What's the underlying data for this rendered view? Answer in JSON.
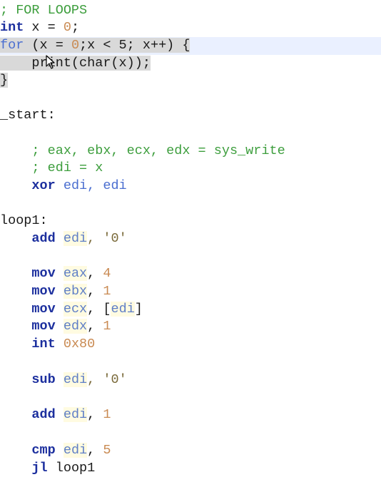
{
  "colors": {
    "keyword": "#1c2f9e",
    "comment": "#3d9e3d",
    "register": "#5f7fc7",
    "number": "#c98a52",
    "selection": "#d9d9d9"
  },
  "code": {
    "comment_for_loops": "; FOR LOOPS",
    "int_kw": "int",
    "x_decl": " x = ",
    "zero": "0",
    "semi": ";",
    "for_kw": "for",
    "for_paren_open": " (x = ",
    "for_zero": "0",
    "for_rest": ";x < 5; x++) {",
    "print_line": "    print(char(x));",
    "close_brace": "}",
    "start_label": "_start:",
    "comment_regs": "    ; eax, ebx, ecx, edx = sys_write",
    "comment_edi": "    ; edi = x",
    "xor_kw": "xor",
    "xor_args": " edi, edi",
    "loop1_label": "loop1:",
    "add_kw": "add",
    "add1_reg": "edi",
    "add1_rest": ", '0'",
    "mov_kw": "mov",
    "mov1_reg": "eax",
    "mov1_val": "4",
    "mov2_reg": "ebx",
    "mov2_val": "1",
    "mov3_reg": "ecx",
    "mov3_open": "[",
    "mov3_inner": "edi",
    "mov3_close": "]",
    "mov4_reg": "edx",
    "mov4_val": "1",
    "int_instr": "int",
    "int_val": "0x80",
    "sub_kw": "sub",
    "sub_reg": "edi",
    "sub_rest": ", '0'",
    "add2_reg": "edi",
    "add2_val": "1",
    "cmp_kw": "cmp",
    "cmp_reg": "edi",
    "cmp_val": "5",
    "jl_kw": "jl",
    "jl_target": " loop1",
    "comma": ", "
  }
}
